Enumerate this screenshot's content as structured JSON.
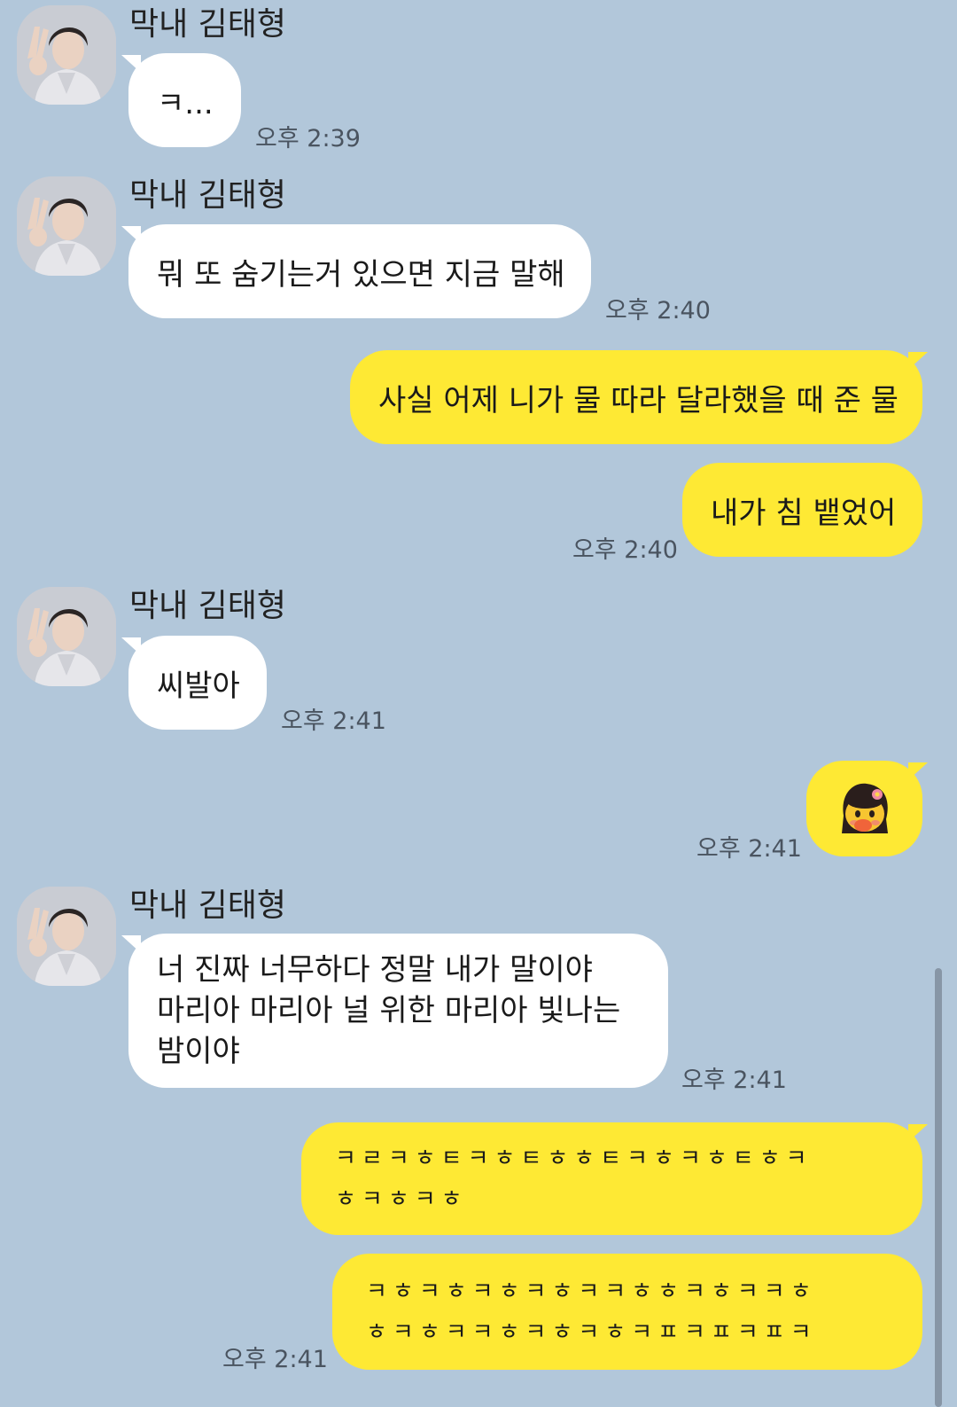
{
  "chat": {
    "sender_name": "막내 김태형",
    "messages": [
      {
        "text": "ㅋ...",
        "time": "오후 2:39"
      },
      {
        "text": "뭐 또 숨기는거 있으면 지금 말해",
        "time": "오후 2:40"
      },
      {
        "text": "사실 어제 니가 물 따라 달라했을 때 준 물"
      },
      {
        "text": "내가 침 뱉었어",
        "time": "오후 2:40"
      },
      {
        "text": "씨발아",
        "time": "오후 2:41"
      },
      {
        "emoticon": "crying-face-sticker",
        "time": "오후 2:41"
      },
      {
        "lines": [
          "너 진짜 너무하다 정말 내가 말이야",
          "마리아 마리아 널 위한 마리아 빛나는",
          "밤이야"
        ],
        "time": "오후 2:41"
      },
      {
        "lines": [
          "ㅋㄹㅋㅎㅌㅋㅎㅌㅎㅎㅌㅋㅎㅋㅎㅌㅎㅋ",
          "ㅎㅋㅎㅋㅎ"
        ]
      },
      {
        "lines": [
          "ㅋㅎㅋㅎㅋㅎㅋㅎㅋㅋㅎㅎㅋㅎㅋㅋㅎ",
          "ㅎㅋㅎㅋㅋㅎㅋㅎㅋㅎㅋㅍㅋㅍㅋㅍㅋ"
        ],
        "time": "오후 2:41"
      }
    ]
  },
  "colors": {
    "background": "#b2c7da",
    "incoming_bubble": "#ffffff",
    "outgoing_bubble": "#fee934"
  }
}
